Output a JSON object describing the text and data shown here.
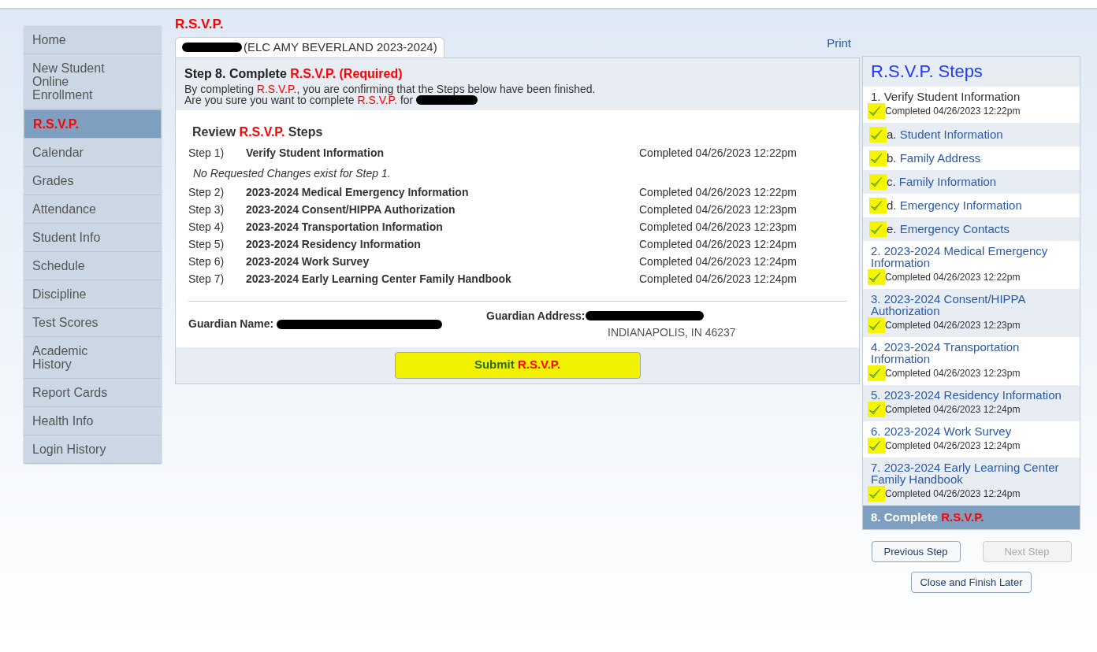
{
  "page_title": [
    {
      "text": "R.S.V.P.",
      "accent": true
    }
  ],
  "nav": [
    {
      "label": "Home",
      "selected": false
    },
    {
      "label": "New Student Online Enrollment",
      "selected": false
    },
    {
      "label": "R.S.V.P.",
      "selected": true
    },
    {
      "label": "Calendar",
      "selected": false
    },
    {
      "label": "Grades",
      "selected": false
    },
    {
      "label": "Attendance",
      "selected": false
    },
    {
      "label": "Student Info",
      "selected": false
    },
    {
      "label": "Schedule",
      "selected": false
    },
    {
      "label": "Discipline",
      "selected": false
    },
    {
      "label": "Test Scores",
      "selected": false
    },
    {
      "label": "Academic History",
      "selected": false
    },
    {
      "label": "Report Cards",
      "selected": false
    },
    {
      "label": "Health Info",
      "selected": false
    },
    {
      "label": "Login History",
      "selected": false
    }
  ],
  "tab": {
    "label": "(ELC AMY BEVERLAND 2023-2024)",
    "selected": true
  },
  "print_link": "Print",
  "step_header": {
    "title": [
      {
        "text": "Step 8. Complete "
      },
      {
        "text": "R.S.V.P. (Required)",
        "accent": true
      }
    ],
    "lines": [
      [
        {
          "text": "By completing "
        },
        {
          "text": "R.S.V.P.",
          "accent": true
        },
        {
          "text": ", you are confirming that the Steps below have been finished."
        }
      ],
      [
        {
          "text": "Are you sure you want to complete "
        },
        {
          "text": "R.S.V.P.",
          "accent": true
        },
        {
          "text": " for"
        }
      ]
    ]
  },
  "review": {
    "title": [
      {
        "text": "Review "
      },
      {
        "text": "R.S.V.P.",
        "accent": true
      },
      {
        "text": " Steps"
      }
    ],
    "steps": [
      {
        "number": "Step 1)",
        "name": "Verify Student Information",
        "status": "Completed 04/26/2023 12:22pm",
        "note": "No Requested Changes exist for Step 1."
      },
      {
        "number": "Step 2)",
        "name": "2023-2024 Medical Emergency Information",
        "status": "Completed 04/26/2023 12:22pm"
      },
      {
        "number": "Step 3)",
        "name": "2023-2024 Consent/HIPPA Authorization",
        "status": "Completed 04/26/2023 12:23pm"
      },
      {
        "number": "Step 4)",
        "name": "2023-2024 Transportation Information",
        "status": "Completed 04/26/2023 12:23pm"
      },
      {
        "number": "Step 5)",
        "name": "2023-2024 Residency Information",
        "status": "Completed 04/26/2023 12:24pm"
      },
      {
        "number": "Step 6)",
        "name": "2023-2024 Work Survey",
        "status": "Completed 04/26/2023 12:24pm"
      },
      {
        "number": "Step 7)",
        "name": "2023-2024 Early Learning Center Family Handbook",
        "status": "Completed 04/26/2023 12:24pm"
      }
    ]
  },
  "guardian": {
    "name_label": "Guardian Name:",
    "address_label": "Guardian Address:",
    "address_line": "INDIANAPOLIS, IN 46237"
  },
  "submit": {
    "label": [
      {
        "text": "Submit "
      },
      {
        "text": "R.S.V.P.",
        "accent": true
      }
    ],
    "highlighted": true
  },
  "sidebar": {
    "title": "R.S.V.P. Steps",
    "steps": [
      {
        "kind": "step",
        "title": "1. Verify Student Information",
        "link": false,
        "status": "Completed 04/26/2023 12:22pm",
        "checked": true,
        "highlighted": true
      },
      {
        "kind": "substep",
        "letter": "a.",
        "title": "Student Information",
        "checked": true,
        "highlighted": true
      },
      {
        "kind": "substep",
        "letter": "b.",
        "title": "Family Address",
        "checked": true,
        "highlighted": true
      },
      {
        "kind": "substep",
        "letter": "c.",
        "title": "Family Information",
        "checked": true,
        "highlighted": true
      },
      {
        "kind": "substep",
        "letter": "d.",
        "title": "Emergency Information",
        "checked": true,
        "highlighted": true
      },
      {
        "kind": "substep",
        "letter": "e.",
        "title": "Emergency Contacts",
        "checked": true,
        "highlighted": true
      },
      {
        "kind": "step",
        "title": "2. 2023-2024 Medical Emergency Information",
        "link": true,
        "status": "Completed 04/26/2023 12:22pm",
        "checked": true,
        "highlighted": true
      },
      {
        "kind": "step",
        "title": "3. 2023-2024 Consent/HIPPA Authorization",
        "link": true,
        "status": "Completed 04/26/2023 12:23pm",
        "checked": true,
        "highlighted": true
      },
      {
        "kind": "step",
        "title": "4. 2023-2024 Transportation Information",
        "link": true,
        "status": "Completed 04/26/2023 12:23pm",
        "checked": true,
        "highlighted": true
      },
      {
        "kind": "step",
        "title": "5. 2023-2024 Residency Information",
        "link": true,
        "status": "Completed 04/26/2023 12:24pm",
        "checked": true,
        "highlighted": true
      },
      {
        "kind": "step",
        "title": "6. 2023-2024 Work Survey",
        "link": true,
        "status": "Completed 04/26/2023 12:24pm",
        "checked": true,
        "highlighted": true
      },
      {
        "kind": "step",
        "title": "7. 2023-2024 Early Learning Center Family Handbook",
        "link": true,
        "status": "Completed 04/26/2023 12:24pm",
        "checked": true,
        "highlighted": true
      },
      {
        "kind": "current",
        "title": [
          {
            "text": "8. Complete "
          },
          {
            "text": "R.S.V.P.",
            "accent": true
          }
        ],
        "selected": true
      }
    ]
  },
  "buttons": [
    {
      "label": "Previous Step",
      "disabled": false
    },
    {
      "label": "Next Step",
      "disabled": true
    },
    {
      "label": "Close and Finish Later",
      "disabled": false
    }
  ]
}
